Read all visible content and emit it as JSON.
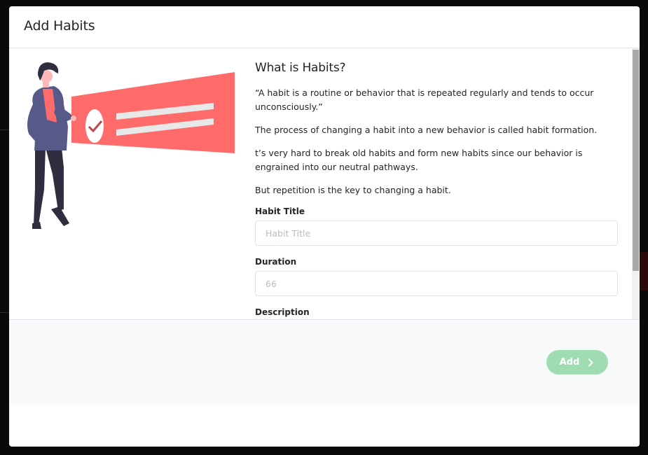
{
  "modal": {
    "title": "Add Habits"
  },
  "info": {
    "heading": "What is Habits?",
    "paragraphs": [
      "“A habit is a routine or behavior that is repeated regularly and tends to occur unconsciously.”",
      "The process of changing a habit into a new behavior is called habit formation.",
      "t’s very hard to break old habits and form new habits since our behavior is engrained into our neutral pathways.",
      "But repetition is the key to changing a habit."
    ]
  },
  "form": {
    "title_label": "Habit Title",
    "title_placeholder": "Habit Title",
    "duration_label": "Duration",
    "duration_placeholder": "66",
    "description_label": "Description"
  },
  "footer": {
    "add_label": "Add"
  },
  "colors": {
    "add_button": "#9fdcb2",
    "banner": "#ff6b6b",
    "figure_jacket": "#575a89",
    "figure_pants": "#2f2e41"
  }
}
